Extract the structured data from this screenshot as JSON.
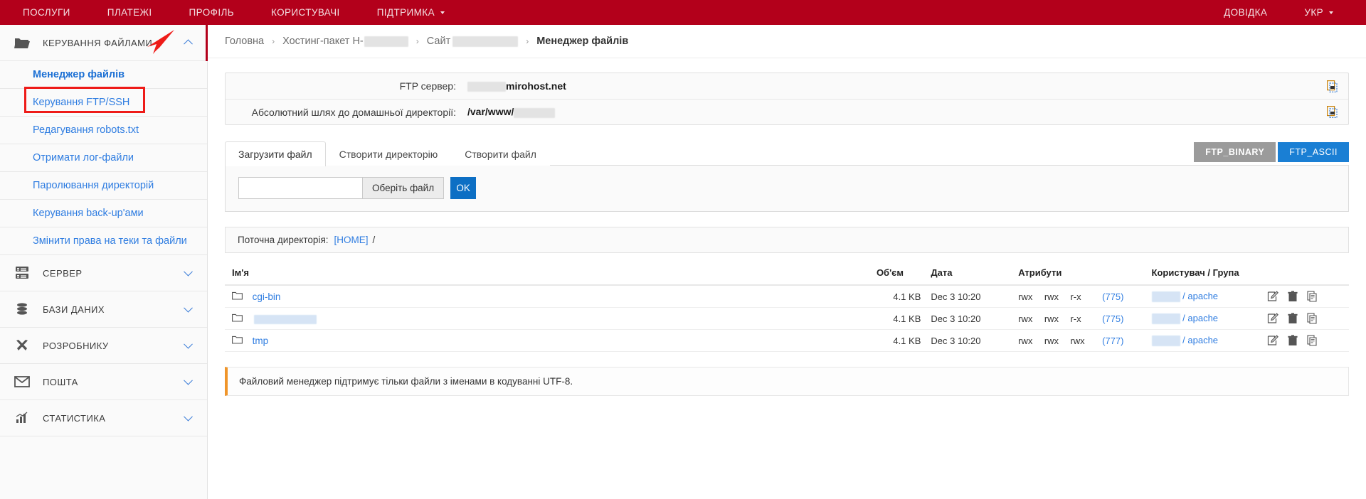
{
  "topbar": {
    "left_items": [
      {
        "label": "ПОСЛУГИ",
        "caret": false
      },
      {
        "label": "ПЛАТЕЖІ",
        "caret": false
      },
      {
        "label": "ПРОФІЛЬ",
        "caret": false
      },
      {
        "label": "КОРИСТУВАЧІ",
        "caret": false
      },
      {
        "label": "ПІДТРИМКА",
        "caret": true
      }
    ],
    "right_items": [
      {
        "label": "ДОВІДКА",
        "caret": false
      },
      {
        "label": "УКР",
        "caret": true
      }
    ],
    "bg_color": "#b3001b"
  },
  "sidebar": {
    "groups": [
      {
        "label": "КЕРУВАННЯ ФАЙЛАМИ",
        "icon": "folder-icon",
        "expanded": true
      },
      {
        "label": "СЕРВЕР",
        "icon": "server-icon",
        "expanded": false
      },
      {
        "label": "БАЗИ ДАНИХ",
        "icon": "database-icon",
        "expanded": false
      },
      {
        "label": "РОЗРОБНИКУ",
        "icon": "tools-icon",
        "expanded": false
      },
      {
        "label": "ПОШТА",
        "icon": "mail-icon",
        "expanded": false
      },
      {
        "label": "СТАТИСТИКА",
        "icon": "chart-icon",
        "expanded": false
      }
    ],
    "file_items": [
      {
        "label": "Менеджер файлів",
        "active": true
      },
      {
        "label": "Керування FTP/SSH",
        "active": false
      },
      {
        "label": "Редагування robots.txt",
        "active": false
      },
      {
        "label": "Отримати лог-файли",
        "active": false
      },
      {
        "label": "Паролювання директорій",
        "active": false
      },
      {
        "label": "Керування back-up'ами",
        "active": false
      },
      {
        "label": "Змінити права на теки та файли",
        "active": false
      }
    ],
    "annotation_color": "#ee1b18"
  },
  "breadcrumb": {
    "home": "Головна",
    "hosting": "Хостинг-пакет H-",
    "site": "Сайт",
    "current": "Менеджер файлів",
    "separator": "›"
  },
  "info": {
    "ftp_server_label": "FTP сервер:",
    "ftp_server_value": "mirohost.net",
    "home_path_label": "Абсолютний шлях до домашньої директорії:",
    "home_path_value": "/var/www/",
    "copy_icon": "copy-icon"
  },
  "tabs": [
    {
      "label": "Загрузити файл",
      "active": true
    },
    {
      "label": "Створити директорію",
      "active": false
    },
    {
      "label": "Створити файл",
      "active": false
    }
  ],
  "ftp_mode": {
    "binary_label": "FTP_BINARY",
    "ascii_label": "FTP_ASCII",
    "binary_color": "#9b9b9b",
    "ascii_color": "#1a7fd4"
  },
  "upload": {
    "input_value": "",
    "choose_label": "Оберіть файл",
    "ok_label": "OK"
  },
  "current_dir": {
    "label": "Поточна директорія:",
    "home": "[HOME]",
    "slash": "/"
  },
  "file_table": {
    "headers": {
      "name": "Ім'я",
      "size": "Об'єм",
      "date": "Дата",
      "attrs": "Атрибути",
      "owner": "Користувач / Група"
    },
    "rows": [
      {
        "name": "cgi-bin",
        "redacted_name": false,
        "size": "4.1 KB",
        "date": "Dec 3 10:20",
        "perm_user": "rwx",
        "perm_group": "rwx",
        "perm_other": "r-x",
        "octal": "(775)",
        "owner_group": "/ apache"
      },
      {
        "name": "",
        "redacted_name": true,
        "size": "4.1 KB",
        "date": "Dec 3 10:20",
        "perm_user": "rwx",
        "perm_group": "rwx",
        "perm_other": "r-x",
        "octal": "(775)",
        "owner_group": "/ apache"
      },
      {
        "name": "tmp",
        "redacted_name": false,
        "size": "4.1 KB",
        "date": "Dec 3 10:20",
        "perm_user": "rwx",
        "perm_group": "rwx",
        "perm_other": "rwx",
        "octal": "(777)",
        "owner_group": "/ apache"
      }
    ],
    "row_actions": [
      "edit-icon",
      "delete-icon",
      "copy-icon"
    ],
    "folder_icon": "folder-icon"
  },
  "notice": {
    "text": "Файловий менеджер підтримує тільки файли з іменами в кодуванні UTF-8.",
    "accent_color": "#f0952a"
  }
}
